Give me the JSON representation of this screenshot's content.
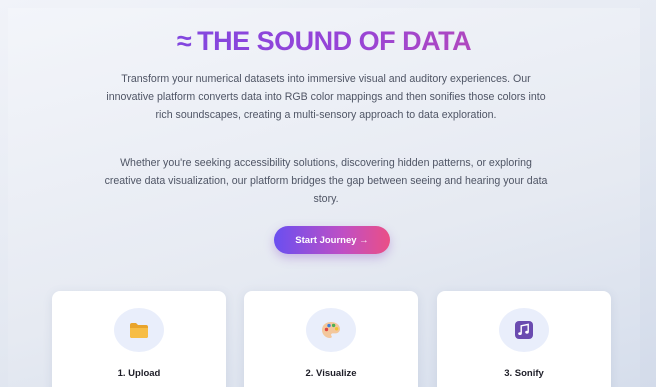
{
  "hero": {
    "symbol": "≈",
    "title": "THE SOUND OF DATA",
    "paragraph1": "Transform your numerical datasets into immersive visual and auditory experiences. Our innovative platform converts data into RGB color mappings and then sonifies those colors into rich soundscapes, creating a multi-sensory approach to data exploration.",
    "paragraph2": "Whether you're seeking accessibility solutions, discovering hidden patterns, or exploring creative data visualization, our platform bridges the gap between seeing and hearing your data story.",
    "cta_label": "Start Journey →"
  },
  "steps": [
    {
      "title": "1. Upload",
      "icon": "folder-icon"
    },
    {
      "title": "2. Visualize",
      "icon": "palette-icon"
    },
    {
      "title": "3. Sonify",
      "icon": "music-note-icon"
    }
  ],
  "colors": {
    "title_gradient_start": "#6d48e8",
    "title_gradient_end": "#d24d9e",
    "cta_gradient_start": "#6a4ff0",
    "cta_gradient_end": "#ea4f86",
    "body_text": "#4f5565",
    "icon_bg": "#e9eefb",
    "folder": "#f5b53a",
    "note": "#6a4bb0"
  }
}
